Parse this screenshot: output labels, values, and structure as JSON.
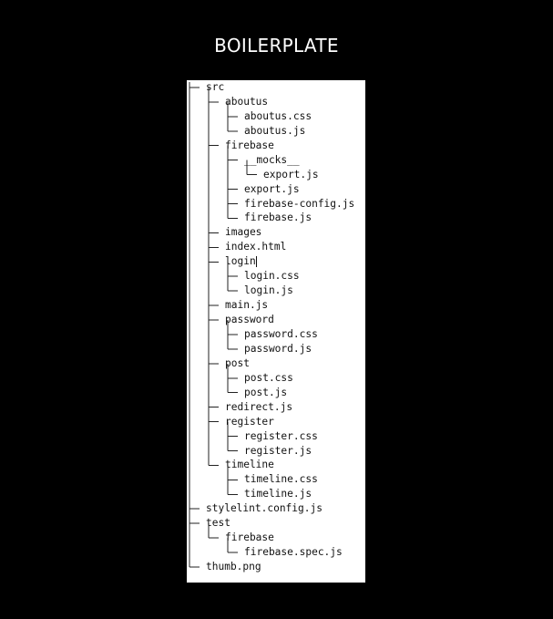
{
  "title": "BOILERPLATE",
  "tree": [
    {
      "label": "src",
      "depth": 0,
      "last": false
    },
    {
      "label": "aboutus",
      "depth": 1,
      "last": false
    },
    {
      "label": "aboutus.css",
      "depth": 2,
      "last": false
    },
    {
      "label": "aboutus.js",
      "depth": 2,
      "last": true
    },
    {
      "label": "firebase",
      "depth": 1,
      "last": false
    },
    {
      "label": "__mocks__",
      "depth": 2,
      "last": false
    },
    {
      "label": "export.js",
      "depth": 3,
      "last": true
    },
    {
      "label": "export.js",
      "depth": 2,
      "last": false
    },
    {
      "label": "firebase-config.js",
      "depth": 2,
      "last": false
    },
    {
      "label": "firebase.js",
      "depth": 2,
      "last": true
    },
    {
      "label": "images",
      "depth": 1,
      "last": false
    },
    {
      "label": "index.html",
      "depth": 1,
      "last": false
    },
    {
      "label": "login",
      "depth": 1,
      "last": false,
      "cursor": true
    },
    {
      "label": "login.css",
      "depth": 2,
      "last": false
    },
    {
      "label": "login.js",
      "depth": 2,
      "last": true
    },
    {
      "label": "main.js",
      "depth": 1,
      "last": false
    },
    {
      "label": "password",
      "depth": 1,
      "last": false
    },
    {
      "label": "password.css",
      "depth": 2,
      "last": false
    },
    {
      "label": "password.js",
      "depth": 2,
      "last": true
    },
    {
      "label": "post",
      "depth": 1,
      "last": false
    },
    {
      "label": "post.css",
      "depth": 2,
      "last": false
    },
    {
      "label": "post.js",
      "depth": 2,
      "last": true
    },
    {
      "label": "redirect.js",
      "depth": 1,
      "last": false
    },
    {
      "label": "register",
      "depth": 1,
      "last": false
    },
    {
      "label": "register.css",
      "depth": 2,
      "last": false
    },
    {
      "label": "register.js",
      "depth": 2,
      "last": true
    },
    {
      "label": "timeline",
      "depth": 1,
      "last": true
    },
    {
      "label": "timeline.css",
      "depth": 2,
      "last": false
    },
    {
      "label": "timeline.js",
      "depth": 2,
      "last": true
    },
    {
      "label": "stylelint.config.js",
      "depth": 0,
      "last": false
    },
    {
      "label": "test",
      "depth": 0,
      "last": false
    },
    {
      "label": "firebase",
      "depth": 1,
      "last": true
    },
    {
      "label": "firebase.spec.js",
      "depth": 2,
      "last": true
    },
    {
      "label": "thumb.png",
      "depth": 0,
      "last": true
    }
  ]
}
